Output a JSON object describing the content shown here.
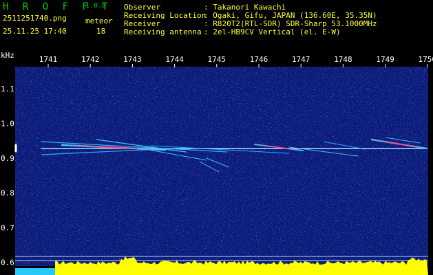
{
  "app": {
    "logo": "H R O F F T",
    "version": "1.0.0"
  },
  "file": {
    "name": "2511251740.png",
    "datetime": "25.11.25 17:40"
  },
  "meteor": {
    "label": "meteor",
    "count": "18"
  },
  "info": [
    {
      "key": "Observer",
      "value": ": Takanori Kawachi"
    },
    {
      "key": "Receiving Location",
      "value": ": Ogaki, Gifu, JAPAN (136.60E, 35.35N)"
    },
    {
      "key": "Receiver",
      "value": ": R820T2(RTL-SDR) SDR-Sharp 53.1000MHz"
    },
    {
      "key": "Receiving antenna",
      "value": ": 2el-HB9CV Vertical (el. E-W)"
    }
  ],
  "axis": {
    "unit": "kHz",
    "y_ticks": [
      "1.1",
      "1.0",
      "0.9",
      "0.8",
      "0.7",
      "0.6"
    ],
    "x_ticks": [
      "1741",
      "1742",
      "1743",
      "1744",
      "1745",
      "1746",
      "1747",
      "1748",
      "1749",
      "1750"
    ]
  },
  "colors": {
    "background": "#000000",
    "spectrum": "#0a1a78",
    "power": "#ffff00",
    "text_yellow": "#ffff33",
    "logo_green": "#00d000"
  }
}
